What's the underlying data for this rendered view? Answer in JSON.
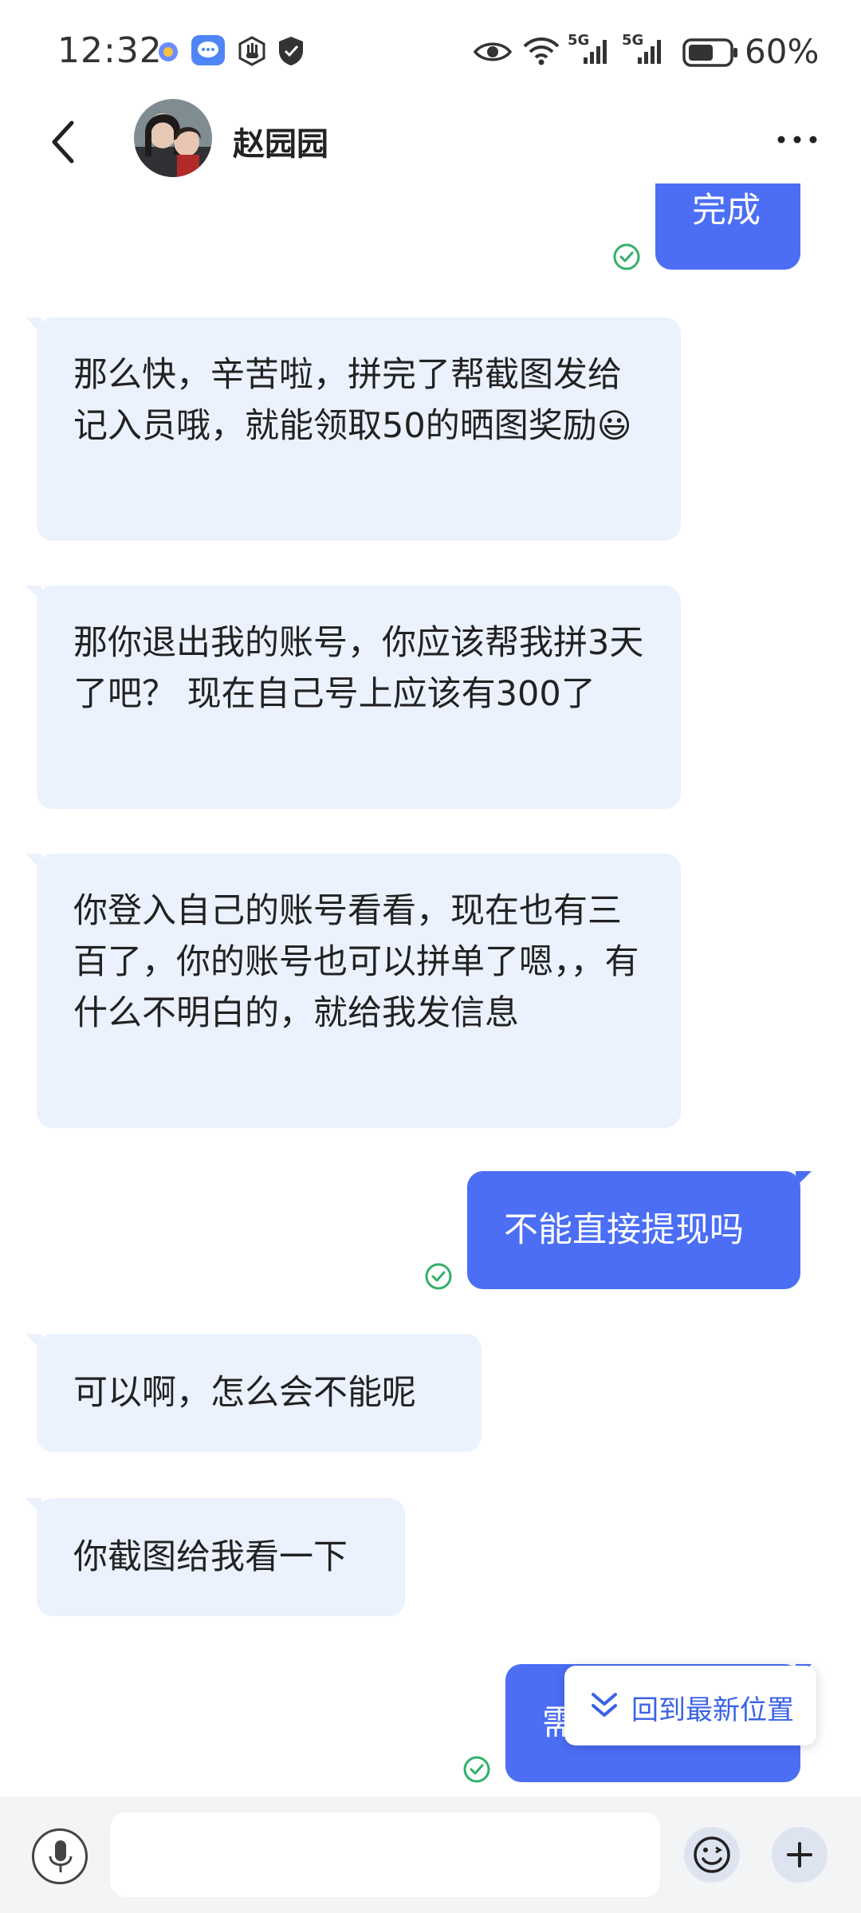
{
  "status_bar": {
    "time": "12:32",
    "battery_percent": "60%",
    "net_5g_a": "5G",
    "net_5g_b": "5G",
    "icons": [
      "wps-icon",
      "message-app-icon",
      "hand-icon",
      "shield-icon",
      "eye-icon",
      "wifi-icon",
      "signal-icon",
      "battery-icon"
    ]
  },
  "header": {
    "contact_name": "赵园园",
    "icons": [
      "back-arrow-icon",
      "more-dots-icon"
    ]
  },
  "messages": [
    {
      "side": "out",
      "text": "完成",
      "sent": true
    },
    {
      "side": "in",
      "text": "那么快，辛苦啦，拼完了帮截图发给记入员哦，就能领取50的晒图奖励",
      "emoji": "😃"
    },
    {
      "side": "in",
      "text": "那你退出我的账号，你应该帮我拼3天了吧？ 现在自己号上应该有300了"
    },
    {
      "side": "in",
      "text": "你登入自己的账号看看，现在也有三百了，你的账号也可以拼单了嗯，，有什么不明白的，就给我发信息"
    },
    {
      "side": "out",
      "text": "不能直接提现吗",
      "sent": true
    },
    {
      "side": "in",
      "text": "可以啊，怎么会不能呢"
    },
    {
      "side": "in",
      "text": "你截图给我看一下"
    },
    {
      "side": "out",
      "text": "需",
      "sent": true
    }
  ],
  "jump_to_latest": {
    "label": "回到最新位置"
  },
  "input_bar": {
    "placeholder": "",
    "icons": [
      "microphone-icon",
      "emoji-icon",
      "plus-icon"
    ]
  },
  "colors": {
    "outgoing": "#4b6ef5",
    "incoming": "#ebf2fe",
    "sent_check": "#33b06a",
    "accent": "#3a62e6"
  }
}
